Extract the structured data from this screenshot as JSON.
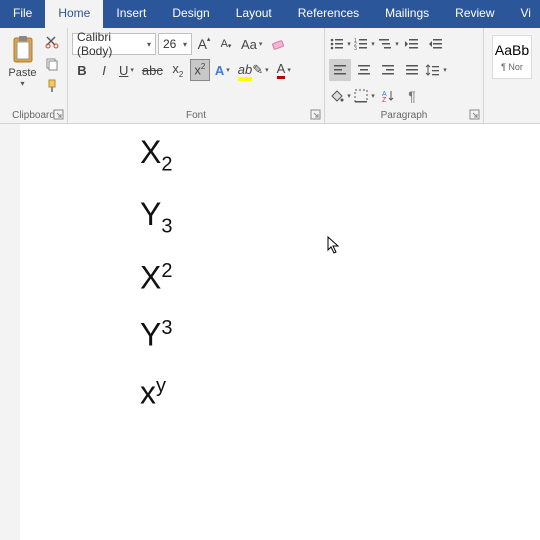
{
  "tabs": {
    "file": "File",
    "home": "Home",
    "insert": "Insert",
    "design": "Design",
    "layout": "Layout",
    "references": "References",
    "mailings": "Mailings",
    "review": "Review",
    "view": "Vi"
  },
  "clipboard": {
    "paste": "Paste",
    "label": "Clipboard"
  },
  "font": {
    "name": "Calibri (Body)",
    "size": "26",
    "label": "Font",
    "bold": "B",
    "italic": "I",
    "underline": "U",
    "x2sub": "x",
    "x2sup": "x",
    "case": "Aa",
    "A_large": "A",
    "A_small": "A",
    "A_font": "A",
    "A_hl": "ab",
    "A_col": "A"
  },
  "paragraph": {
    "label": "Paragraph"
  },
  "styles": {
    "preview": "AaBb",
    "name": "¶ Nor"
  },
  "document": {
    "lines": [
      {
        "base": "X",
        "script": "2",
        "pos": "sub"
      },
      {
        "base": "Y",
        "script": "3",
        "pos": "sub"
      },
      {
        "base": "X",
        "script": "2",
        "pos": "sup"
      },
      {
        "base": "Y",
        "script": "3",
        "pos": "sup"
      },
      {
        "base": "x",
        "script": "y",
        "pos": "sup"
      }
    ]
  }
}
